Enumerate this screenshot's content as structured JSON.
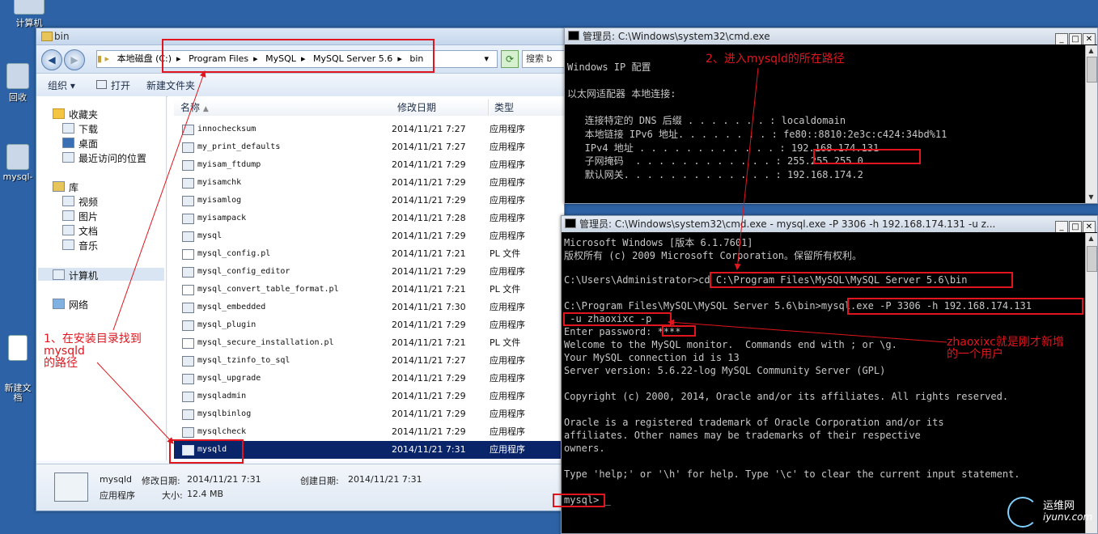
{
  "desktop": {
    "icons": [
      "计算机",
      "回收",
      "mysql-",
      "新建文\n档"
    ]
  },
  "explorer": {
    "title": "bin",
    "address": [
      "本地磁盘 (C:)",
      "Program Files",
      "MySQL",
      "MySQL Server 5.6",
      "bin"
    ],
    "search_placeholder": "搜索 b",
    "toolbar": {
      "organize": "组织 ▾",
      "open": "打开",
      "new_folder": "新建文件夹"
    },
    "nav": {
      "favorites": "收藏夹",
      "downloads": "下载",
      "desktop": "桌面",
      "recent": "最近访问的位置",
      "libraries": "库",
      "videos": "视频",
      "pictures": "图片",
      "documents": "文档",
      "music": "音乐",
      "computer": "计算机",
      "network": "网络"
    },
    "columns": {
      "name": "名称",
      "date": "修改日期",
      "type": "类型"
    },
    "files": [
      {
        "name": "innochecksum",
        "date": "2014/11/21 7:27",
        "type": "应用程序",
        "doc": false
      },
      {
        "name": "my_print_defaults",
        "date": "2014/11/21 7:27",
        "type": "应用程序",
        "doc": false
      },
      {
        "name": "myisam_ftdump",
        "date": "2014/11/21 7:29",
        "type": "应用程序",
        "doc": false
      },
      {
        "name": "myisamchk",
        "date": "2014/11/21 7:29",
        "type": "应用程序",
        "doc": false
      },
      {
        "name": "myisamlog",
        "date": "2014/11/21 7:29",
        "type": "应用程序",
        "doc": false
      },
      {
        "name": "myisampack",
        "date": "2014/11/21 7:28",
        "type": "应用程序",
        "doc": false
      },
      {
        "name": "mysql",
        "date": "2014/11/21 7:29",
        "type": "应用程序",
        "doc": false
      },
      {
        "name": "mysql_config.pl",
        "date": "2014/11/21 7:21",
        "type": "PL 文件",
        "doc": true
      },
      {
        "name": "mysql_config_editor",
        "date": "2014/11/21 7:29",
        "type": "应用程序",
        "doc": false
      },
      {
        "name": "mysql_convert_table_format.pl",
        "date": "2014/11/21 7:21",
        "type": "PL 文件",
        "doc": true
      },
      {
        "name": "mysql_embedded",
        "date": "2014/11/21 7:30",
        "type": "应用程序",
        "doc": false
      },
      {
        "name": "mysql_plugin",
        "date": "2014/11/21 7:29",
        "type": "应用程序",
        "doc": false
      },
      {
        "name": "mysql_secure_installation.pl",
        "date": "2014/11/21 7:21",
        "type": "PL 文件",
        "doc": true
      },
      {
        "name": "mysql_tzinfo_to_sql",
        "date": "2014/11/21 7:27",
        "type": "应用程序",
        "doc": false
      },
      {
        "name": "mysql_upgrade",
        "date": "2014/11/21 7:29",
        "type": "应用程序",
        "doc": false
      },
      {
        "name": "mysqladmin",
        "date": "2014/11/21 7:29",
        "type": "应用程序",
        "doc": false
      },
      {
        "name": "mysqlbinlog",
        "date": "2014/11/21 7:29",
        "type": "应用程序",
        "doc": false
      },
      {
        "name": "mysqlcheck",
        "date": "2014/11/21 7:29",
        "type": "应用程序",
        "doc": false
      },
      {
        "name": "mysqld",
        "date": "2014/11/21 7:31",
        "type": "应用程序",
        "doc": false,
        "selected": true
      }
    ],
    "details": {
      "name": "mysqld",
      "modified_label": "修改日期:",
      "modified": "2014/11/21 7:31",
      "created_label": "创建日期:",
      "created": "2014/11/21 7:31",
      "type": "应用程序",
      "size_label": "大小:",
      "size": "12.4 MB"
    }
  },
  "cmd1": {
    "title": "管理员: C:\\Windows\\system32\\cmd.exe",
    "lines": [
      "Windows IP 配置",
      "",
      "以太网适配器 本地连接:",
      "",
      "   连接特定的 DNS 后缀 . . . . . . . : localdomain",
      "   本地链接 IPv6 地址. . . . . . . . : fe80::8810:2e3c:c424:34bd%11",
      "   IPv4 地址 . . . . . . . . . . . . : 192.168.174.131",
      "   子网掩码  . . . . . . . . . . . . : 255.255.255.0",
      "   默认网关. . . . . . . . . . . . . : 192.168.174.2"
    ]
  },
  "cmd2": {
    "title": "管理员: C:\\Windows\\system32\\cmd.exe - mysql.exe  -P 3306 -h 192.168.174.131  -u z...",
    "lines": [
      "Microsoft Windows [版本 6.1.7601]",
      "版权所有 (c) 2009 Microsoft Corporation。保留所有权利。",
      "",
      "C:\\Users\\Administrator>cd C:\\Program Files\\MySQL\\MySQL Server 5.6\\bin",
      "",
      "C:\\Program Files\\MySQL\\MySQL Server 5.6\\bin>mysql.exe -P 3306 -h 192.168.174.131",
      " -u zhaoxixc -p",
      "Enter password: ****",
      "Welcome to the MySQL monitor.  Commands end with ; or \\g.",
      "Your MySQL connection id is 13",
      "Server version: 5.6.22-log MySQL Community Server (GPL)",
      "",
      "Copyright (c) 2000, 2014, Oracle and/or its affiliates. All rights reserved.",
      "",
      "Oracle is a registered trademark of Oracle Corporation and/or its",
      "affiliates. Other names may be trademarks of their respective",
      "owners.",
      "",
      "Type 'help;' or '\\h' for help. Type '\\c' to clear the current input statement.",
      "",
      "mysql> _"
    ]
  },
  "annotations": {
    "step1": "1、在安装目录找到\nmysqld\n的路径",
    "step2": "2、进入mysqld的所在路径",
    "user_note": "zhaoxixc就是刚才新增\n的一个用户"
  },
  "watermark": {
    "line1": "运维网",
    "line2": "iyunv.com"
  }
}
